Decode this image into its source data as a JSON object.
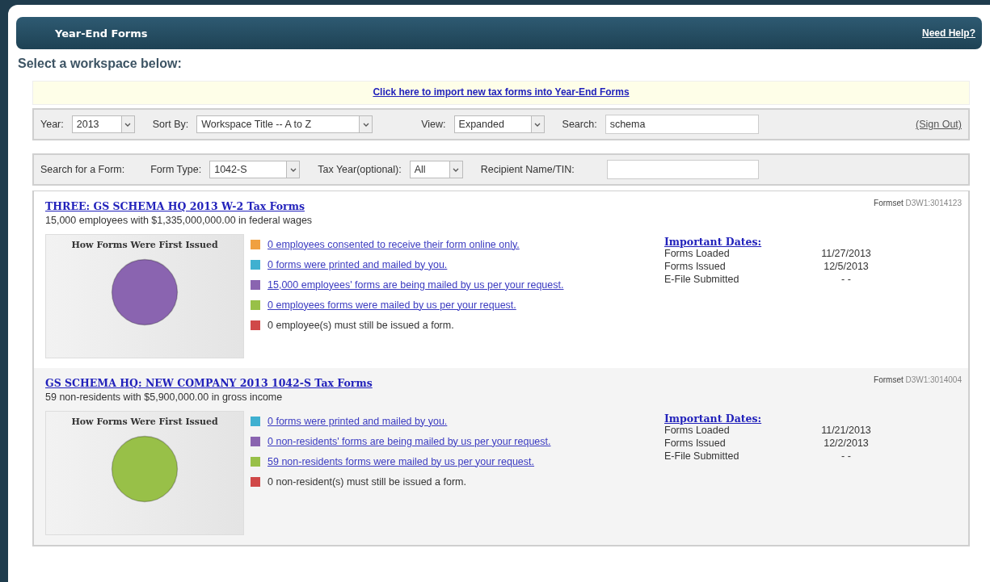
{
  "header": {
    "title": "Year-End Forms",
    "help_link": "Need Help?"
  },
  "prompt": "Select a workspace below:",
  "import_link": "Click here to import new tax forms into Year-End Forms",
  "filters": {
    "year_label": "Year:",
    "year": "2013",
    "sort_label": "Sort By:",
    "sort": "Workspace Title -- A to Z",
    "view_label": "View:",
    "view": "Expanded",
    "search_label": "Search:",
    "search": "schema",
    "sign_out": "(Sign Out)"
  },
  "form_search": {
    "label": "Search for a Form:",
    "type_label": "Form Type:",
    "type": "1042-S",
    "tax_year_label": "Tax Year(optional):",
    "tax_year": "All",
    "recipient_label": "Recipient Name/TIN:"
  },
  "workspaces": [
    {
      "title": "THREE: GS SCHEMA HQ 2013 W-2 Tax Forms",
      "summary": "15,000 employees with $1,335,000,000.00 in federal wages",
      "formset_label": "Formset",
      "formset": "D3W1:3014123",
      "chart_data": {
        "type": "pie",
        "title": "How Forms Were First Issued",
        "values": [
          0,
          0,
          100,
          0,
          0
        ]
      },
      "legend": [
        {
          "text": "0 employees consented to receive their form online only.",
          "color": "#f0a040",
          "kind": "link"
        },
        {
          "text": "0 forms were printed and mailed by you.",
          "color": "#40b0d0",
          "kind": "link"
        },
        {
          "text": "15,000 employees' forms are being mailed by us per your request.",
          "color": "#8a64b0",
          "kind": "link"
        },
        {
          "text": "0 employees forms were mailed by us per your request.",
          "color": "#98c048",
          "kind": "link"
        },
        {
          "text": "0 employee(s) must still be issued a form.",
          "color": "#d04848",
          "kind": "text"
        }
      ],
      "dates_title": "Important Dates:",
      "dates": [
        {
          "label": "Forms Loaded",
          "value": "11/27/2013"
        },
        {
          "label": "Forms Issued",
          "value": "12/5/2013"
        },
        {
          "label": "E-File Submitted",
          "value": "- -"
        }
      ]
    },
    {
      "title": "GS SCHEMA HQ: NEW COMPANY 2013 1042-S Tax Forms",
      "summary": "59 non-residents with $5,900,000.00 in gross income",
      "formset_label": "Formset",
      "formset": "D3W1:3014004",
      "chart_data": {
        "type": "pie",
        "title": "How Forms Were First Issued",
        "values": [
          0,
          0,
          100,
          0
        ]
      },
      "legend": [
        {
          "text": "0 forms were printed and mailed by you.",
          "color": "#40b0d0",
          "kind": "link"
        },
        {
          "text": "0 non-residents' forms are being mailed by us per your request.",
          "color": "#8a64b0",
          "kind": "link"
        },
        {
          "text": "59 non-residents forms were mailed by us per your request.",
          "color": "#98c048",
          "kind": "link"
        },
        {
          "text": "0 non-resident(s) must still be issued a form.",
          "color": "#d04848",
          "kind": "text"
        }
      ],
      "dates_title": "Important Dates:",
      "dates": [
        {
          "label": "Forms Loaded",
          "value": "11/21/2013"
        },
        {
          "label": "Forms Issued",
          "value": "12/2/2013"
        },
        {
          "label": "E-File Submitted",
          "value": "- -"
        }
      ]
    }
  ]
}
